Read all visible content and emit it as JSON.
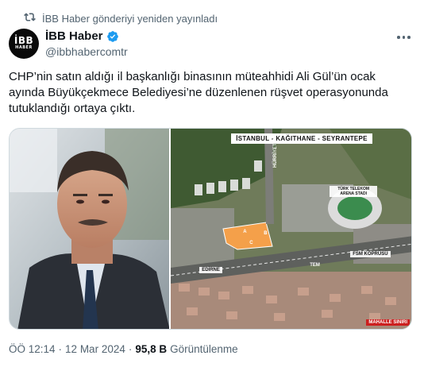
{
  "repost": {
    "text": "İBB Haber gönderiyi yeniden yayınladı",
    "icon": "repost-icon"
  },
  "author": {
    "name": "İBB Haber",
    "handle": "@ibbhabercomtr",
    "verified": true,
    "avatar_logo_main": "İBB",
    "avatar_logo_sub": "HABER"
  },
  "tweet": {
    "text": "CHP’nin satın aldığı il başkanlığı binasının müteahhidi Ali Gül’ün ocak ayında Büyükçekmece Belediyesi’ne düzenlenen rüşvet operasyonunda tutuklandığı ortaya çıktı."
  },
  "media": {
    "map": {
      "banner": "İSTANBUL - KAĞITHANE - SEYRANTEPE",
      "stadium_label": "TÜRK TELEKOM ARENA STADI",
      "bridge_label": "FSM KÖPRÜSÜ",
      "highway_label": "TEM",
      "edirne_label": "EDİRNE",
      "street_label": "HÜRRİYET CD.",
      "footer": "MAHALLE SINIRI",
      "parcel_labels": [
        "A",
        "B",
        "C"
      ]
    }
  },
  "meta": {
    "time": "ÖÖ 12:14",
    "separator": "·",
    "date": "12 Mar 2024",
    "views_count": "95,8 B",
    "views_label": "Görüntülenme"
  },
  "colors": {
    "text_primary": "#0f1419",
    "text_secondary": "#536471",
    "verified_blue": "#1d9bf0",
    "border": "#cfd9de",
    "parcel_orange": "#f4a04a"
  }
}
